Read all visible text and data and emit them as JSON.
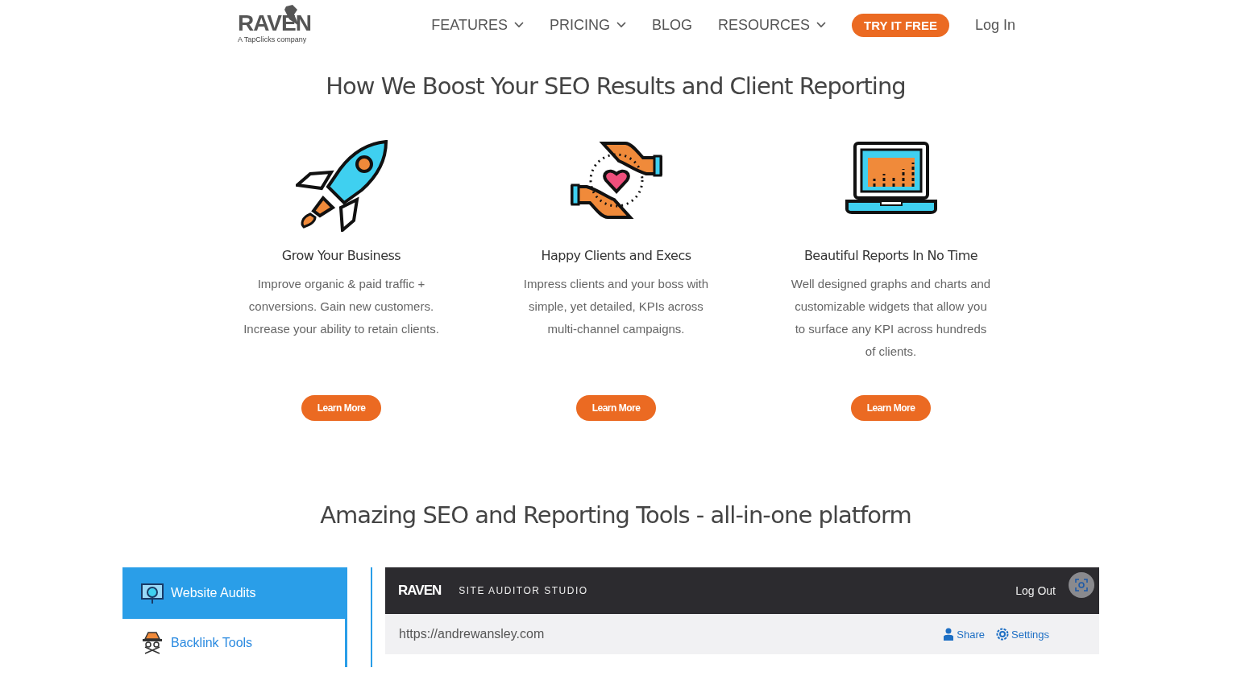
{
  "header": {
    "logo": {
      "name": "RAVEN",
      "tagline": "A TapClicks company"
    },
    "nav": [
      {
        "label": "FEATURES",
        "dropdown": true
      },
      {
        "label": "PRICING",
        "dropdown": true
      },
      {
        "label": "BLOG",
        "dropdown": false
      },
      {
        "label": "RESOURCES",
        "dropdown": true
      }
    ],
    "cta": "TRY IT FREE",
    "login": "Log In"
  },
  "benefits": {
    "title": "How We Boost Your SEO Results and Client Reporting",
    "items": [
      {
        "title": "Grow Your Business",
        "text": "Improve organic & paid traffic + conversions. Gain new customers. Increase your ability to retain clients.",
        "button": "Learn More"
      },
      {
        "title": "Happy Clients and Execs",
        "text": "Impress clients and your boss with simple, yet detailed, KPIs across multi-channel campaigns.",
        "button": "Learn More"
      },
      {
        "title": "Beautiful Reports In No Time",
        "text": "Well designed graphs and charts and customizable widgets that allow you to surface any KPI across hundreds of clients.",
        "button": "Learn More"
      }
    ]
  },
  "tools": {
    "title": "Amazing SEO and Reporting Tools - all-in-one platform",
    "sidebar": [
      {
        "label": "Website Audits",
        "selected": true
      },
      {
        "label": "Backlink Tools",
        "selected": false
      }
    ],
    "app": {
      "logo": "RAVEN",
      "title": "SITE AUDITOR STUDIO",
      "logout": "Log Out",
      "url": "https://andrewansley.com",
      "share": "Share",
      "settings": "Settings"
    }
  }
}
